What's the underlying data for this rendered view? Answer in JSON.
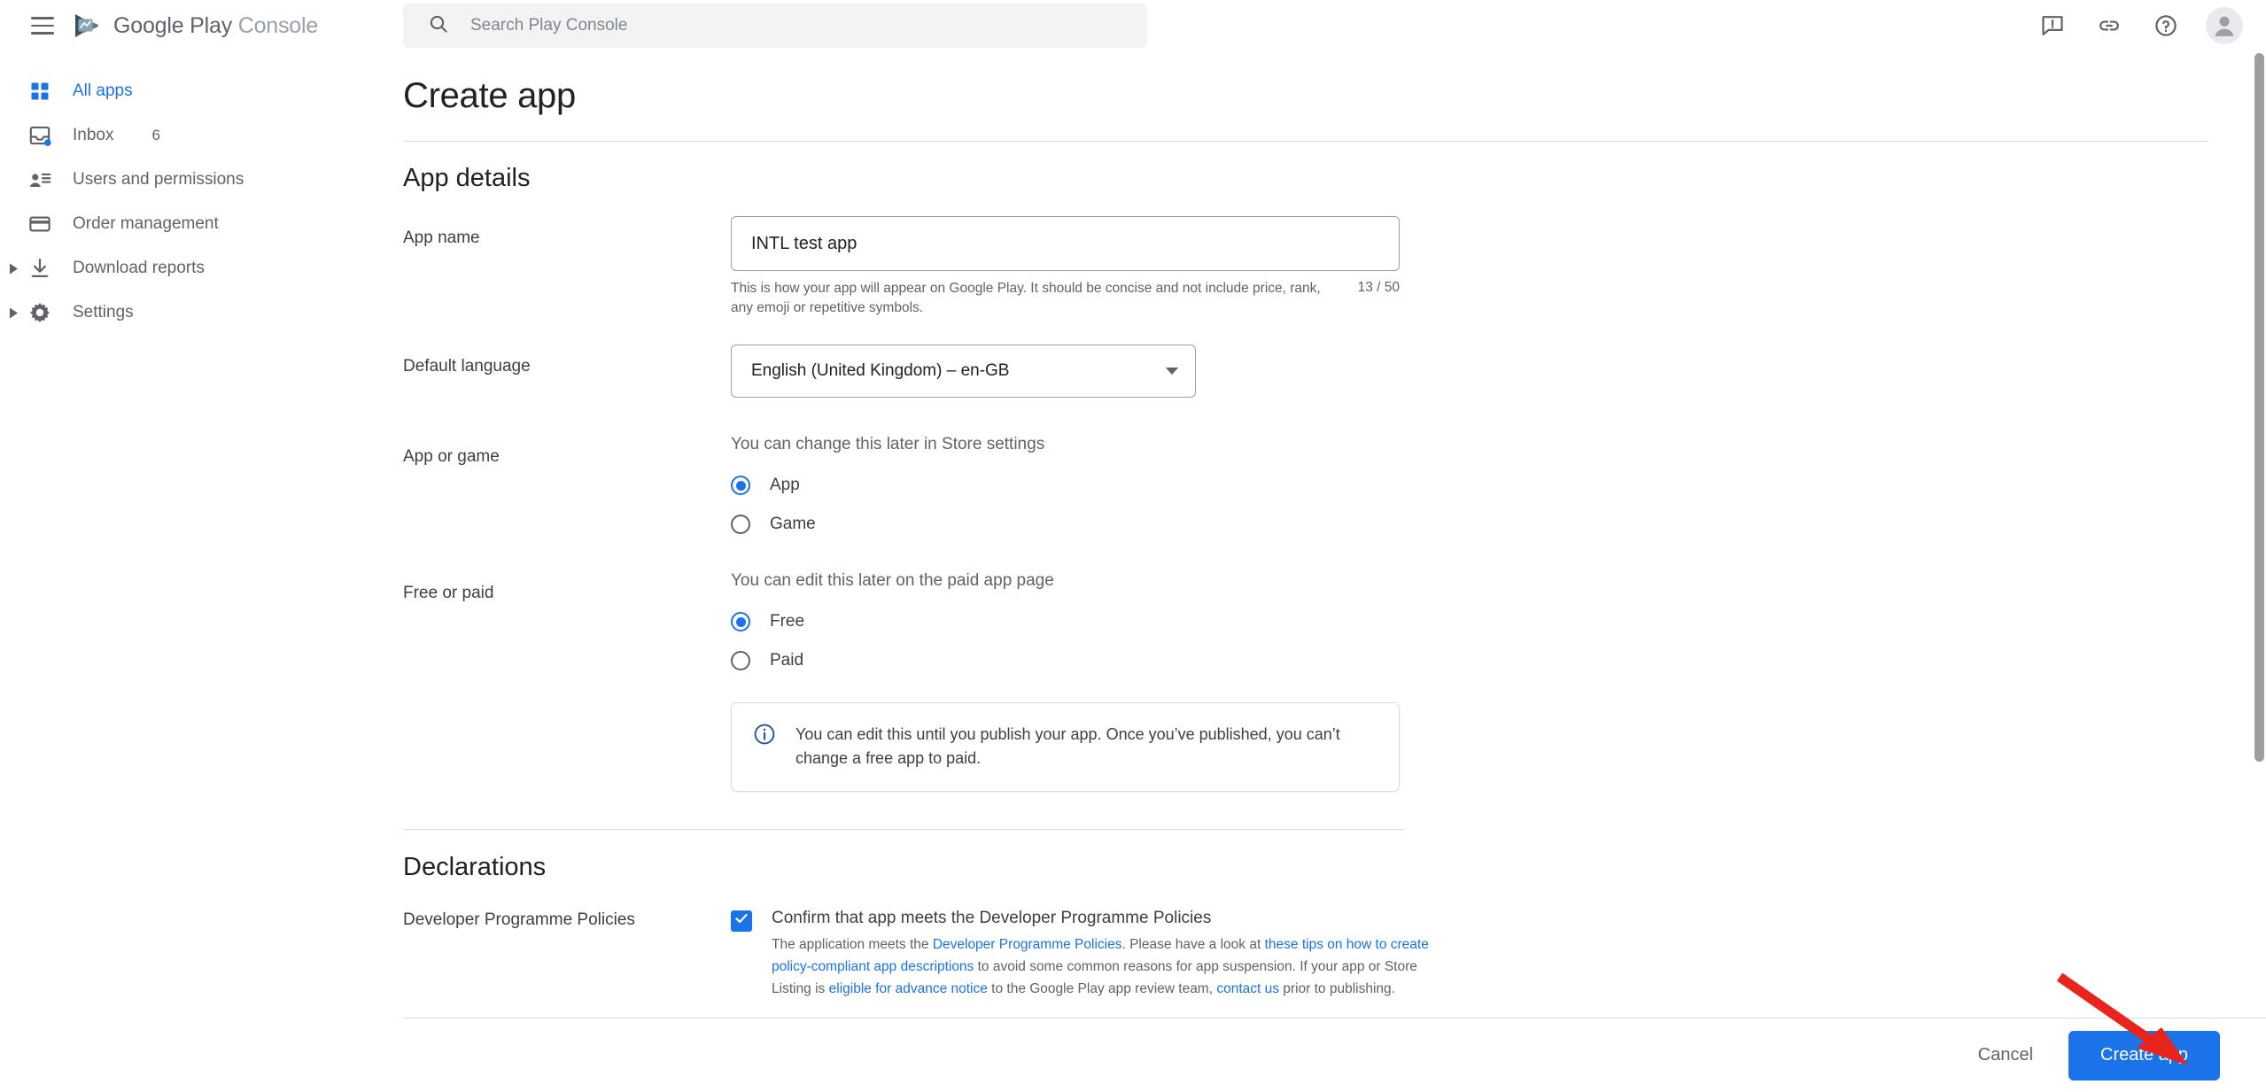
{
  "header": {
    "menu_label": "Main menu",
    "brand_first": "Google Play",
    "brand_second": "Console",
    "logo_icon": "google-play-console-logo",
    "search": {
      "placeholder": "Search Play Console",
      "value": "",
      "icon": "search-icon"
    },
    "icons": [
      {
        "name": "feedback-icon",
        "title": "Send feedback"
      },
      {
        "name": "link-icon",
        "title": "Link"
      },
      {
        "name": "help-icon",
        "title": "Help"
      },
      {
        "name": "avatar",
        "title": "Account"
      }
    ]
  },
  "sidebar": {
    "items": [
      {
        "label": "All apps",
        "icon": "grid-apps-icon",
        "active": true,
        "badge": "",
        "expandable": false,
        "dot": false
      },
      {
        "label": "Inbox",
        "icon": "inbox-icon",
        "active": false,
        "badge": "6",
        "expandable": false,
        "dot": true
      },
      {
        "label": "Users and permissions",
        "icon": "users-icon",
        "active": false,
        "badge": "",
        "expandable": false,
        "dot": false
      },
      {
        "label": "Order management",
        "icon": "card-icon",
        "active": false,
        "badge": "",
        "expandable": false,
        "dot": false
      },
      {
        "label": "Download reports",
        "icon": "download-icon",
        "active": false,
        "badge": "",
        "expandable": true,
        "dot": false
      },
      {
        "label": "Settings",
        "icon": "gear-icon",
        "active": false,
        "badge": "",
        "expandable": true,
        "dot": false
      }
    ]
  },
  "main": {
    "page_title": "Create app",
    "app_details": {
      "section_title": "App details",
      "app_name": {
        "label": "App name",
        "value": "INTL test app",
        "helper": "This is how your app will appear on Google Play. It should be concise and not include price, rank, any emoji or repetitive symbols.",
        "counter": "13 / 50"
      },
      "default_language": {
        "label": "Default language",
        "value": "English (United Kingdom) – en-GB",
        "icon": "chevron-down-icon"
      },
      "app_or_game": {
        "label": "App or game",
        "hint": "You can change this later in Store settings",
        "options": [
          {
            "label": "App",
            "selected": true
          },
          {
            "label": "Game",
            "selected": false
          }
        ]
      },
      "free_or_paid": {
        "label": "Free or paid",
        "hint": "You can edit this later on the paid app page",
        "options": [
          {
            "label": "Free",
            "selected": true
          },
          {
            "label": "Paid",
            "selected": false
          }
        ]
      },
      "info_box": {
        "icon": "info-icon",
        "text": "You can edit this until you publish your app. Once you’ve published, you can’t change a free app to paid."
      }
    },
    "declarations": {
      "section_title": "Declarations",
      "row_label": "Developer Programme Policies",
      "checkbox": {
        "checked": true,
        "icon": "check-icon",
        "title": "Confirm that app meets the Developer Programme Policies"
      },
      "body_parts": [
        {
          "text": "The application meets the ",
          "link": false
        },
        {
          "text": "Developer Programme Policies",
          "link": true
        },
        {
          "text": ". Please have a look at ",
          "link": false
        },
        {
          "text": "these tips on how to create policy-compliant app descriptions",
          "link": true
        },
        {
          "text": " to avoid some common reasons for app suspension. If your app or Store Listing is ",
          "link": false
        },
        {
          "text": "eligible for advance notice",
          "link": true
        },
        {
          "text": " to the Google Play app review team, ",
          "link": false
        },
        {
          "text": "contact us",
          "link": true
        },
        {
          "text": " prior to publishing.",
          "link": false
        }
      ]
    }
  },
  "footer": {
    "cancel_label": "Cancel",
    "create_label": "Create app"
  },
  "annotation": {
    "arrow_name": "red-pointer-arrow",
    "color": "#e8241c",
    "points_to": "create-app-button"
  },
  "colors": {
    "accent": "#1a73e8",
    "text_primary": "#202124",
    "text_secondary": "#5f6368",
    "border": "#dadce0",
    "search_bg": "#f1f3f4",
    "info_icon": "#174ea6"
  }
}
